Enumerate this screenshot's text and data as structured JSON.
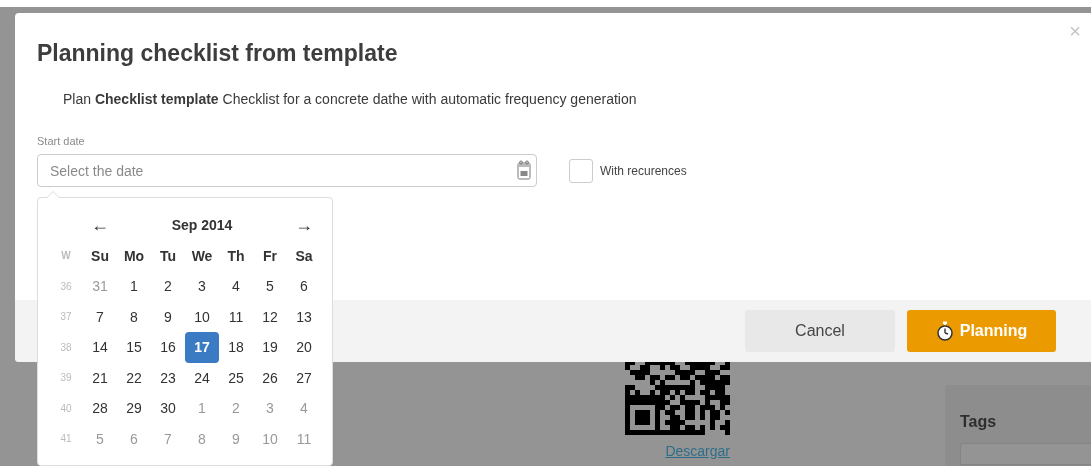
{
  "background": {
    "link": "Descargar",
    "tags_label": "Tags"
  },
  "dialog": {
    "title": "Planning checklist from template",
    "close": "×",
    "description": "Plan **Checklist template** Checklist for a concrete dathe with automatic frequency generation",
    "start_date": {
      "label": "Start date",
      "placeholder": "Select the date"
    },
    "recurrences": {
      "label": "With recurences",
      "checked": false
    },
    "buttons": [
      {
        "label": "Cancel",
        "kind": "secondary"
      },
      {
        "label": "Planning",
        "kind": "primary"
      }
    ]
  },
  "calendar": {
    "month": "Sep 2014",
    "prev": "←",
    "next": "→",
    "week_header": "W",
    "weekdays": [
      "Su",
      "Mo",
      "Tu",
      "We",
      "Th",
      "Fr",
      "Sa"
    ],
    "weeks": [
      {
        "number": "36",
        "days": [
          {
            "day": "31",
            "other_month": true,
            "selected": false
          },
          {
            "day": "1",
            "other_month": false,
            "selected": false
          },
          {
            "day": "2",
            "other_month": false,
            "selected": false
          },
          {
            "day": "3",
            "other_month": false,
            "selected": false
          },
          {
            "day": "4",
            "other_month": false,
            "selected": false
          },
          {
            "day": "5",
            "other_month": false,
            "selected": false
          },
          {
            "day": "6",
            "other_month": false,
            "selected": false
          }
        ]
      },
      {
        "number": "37",
        "days": [
          {
            "day": "7",
            "other_month": false,
            "selected": false
          },
          {
            "day": "8",
            "other_month": false,
            "selected": false
          },
          {
            "day": "9",
            "other_month": false,
            "selected": false
          },
          {
            "day": "10",
            "other_month": false,
            "selected": false
          },
          {
            "day": "11",
            "other_month": false,
            "selected": false
          },
          {
            "day": "12",
            "other_month": false,
            "selected": false
          },
          {
            "day": "13",
            "other_month": false,
            "selected": false
          }
        ]
      },
      {
        "number": "38",
        "days": [
          {
            "day": "14",
            "other_month": false,
            "selected": false
          },
          {
            "day": "15",
            "other_month": false,
            "selected": false
          },
          {
            "day": "16",
            "other_month": false,
            "selected": false
          },
          {
            "day": "17",
            "other_month": false,
            "selected": true
          },
          {
            "day": "18",
            "other_month": false,
            "selected": false
          },
          {
            "day": "19",
            "other_month": false,
            "selected": false
          },
          {
            "day": "20",
            "other_month": false,
            "selected": false
          }
        ]
      },
      {
        "number": "39",
        "days": [
          {
            "day": "21",
            "other_month": false,
            "selected": false
          },
          {
            "day": "22",
            "other_month": false,
            "selected": false
          },
          {
            "day": "23",
            "other_month": false,
            "selected": false
          },
          {
            "day": "24",
            "other_month": false,
            "selected": false
          },
          {
            "day": "25",
            "other_month": false,
            "selected": false
          },
          {
            "day": "26",
            "other_month": false,
            "selected": false
          },
          {
            "day": "27",
            "other_month": false,
            "selected": false
          }
        ]
      },
      {
        "number": "40",
        "days": [
          {
            "day": "28",
            "other_month": false,
            "selected": false
          },
          {
            "day": "29",
            "other_month": false,
            "selected": false
          },
          {
            "day": "30",
            "other_month": false,
            "selected": false
          },
          {
            "day": "1",
            "other_month": true,
            "selected": false
          },
          {
            "day": "2",
            "other_month": true,
            "selected": false
          },
          {
            "day": "3",
            "other_month": true,
            "selected": false
          },
          {
            "day": "4",
            "other_month": true,
            "selected": false
          }
        ]
      },
      {
        "number": "41",
        "days": [
          {
            "day": "5",
            "other_month": true,
            "selected": false
          },
          {
            "day": "6",
            "other_month": true,
            "selected": false
          },
          {
            "day": "7",
            "other_month": true,
            "selected": false
          },
          {
            "day": "8",
            "other_month": true,
            "selected": false
          },
          {
            "day": "9",
            "other_month": true,
            "selected": false
          },
          {
            "day": "10",
            "other_month": true,
            "selected": false
          },
          {
            "day": "11",
            "other_month": true,
            "selected": false
          }
        ]
      }
    ]
  }
}
